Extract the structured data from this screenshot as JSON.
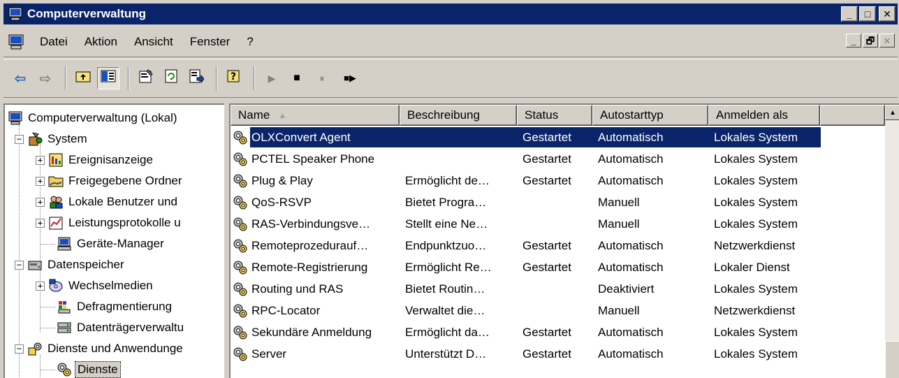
{
  "window": {
    "title": "Computerverwaltung",
    "buttons": {
      "minimize": "_",
      "maximize": "□",
      "close": "✕"
    }
  },
  "menu": {
    "items": [
      "Datei",
      "Aktion",
      "Ansicht",
      "Fenster",
      "?"
    ],
    "child_buttons": {
      "minimize": "_",
      "restore": "🗗",
      "close": "✕"
    }
  },
  "toolbar": {
    "back": "⇦",
    "forward": "⇨",
    "play": "▶",
    "stop": "■",
    "pause": "⏸",
    "restart": "■▶"
  },
  "tree": {
    "root": "Computerverwaltung (Lokal)",
    "items": [
      {
        "label": "System",
        "expander": "−",
        "icon": "tools-icon"
      },
      {
        "label": "Ereignisanzeige",
        "expander": "+",
        "icon": "event-viewer-icon"
      },
      {
        "label": "Freigegebene Ordner",
        "expander": "+",
        "icon": "shared-folder-icon"
      },
      {
        "label": "Lokale Benutzer und",
        "expander": "+",
        "icon": "users-icon"
      },
      {
        "label": "Leistungsprotokolle u",
        "expander": "+",
        "icon": "performance-icon"
      },
      {
        "label": "Geräte-Manager",
        "expander": "",
        "icon": "device-manager-icon"
      },
      {
        "label": "Datenspeicher",
        "expander": "−",
        "icon": "storage-icon"
      },
      {
        "label": "Wechselmedien",
        "expander": "+",
        "icon": "removable-media-icon"
      },
      {
        "label": "Defragmentierung",
        "expander": "",
        "icon": "defrag-icon"
      },
      {
        "label": "Datenträgerverwaltu",
        "expander": "",
        "icon": "disk-management-icon"
      },
      {
        "label": "Dienste und Anwendunge",
        "expander": "−",
        "icon": "services-apps-icon"
      },
      {
        "label": "Dienste",
        "expander": "",
        "icon": "services-icon"
      }
    ]
  },
  "list": {
    "columns": [
      "Name",
      "Beschreibung",
      "Status",
      "Autostarttyp",
      "Anmelden als"
    ],
    "sort_indicator": "▲",
    "rows": [
      {
        "name": "OLXConvert Agent",
        "desc": "",
        "status": "Gestartet",
        "startup": "Automatisch",
        "logon": "Lokales System"
      },
      {
        "name": "PCTEL Speaker Phone",
        "desc": "",
        "status": "Gestartet",
        "startup": "Automatisch",
        "logon": "Lokales System"
      },
      {
        "name": "Plug & Play",
        "desc": "Ermöglicht de…",
        "status": "Gestartet",
        "startup": "Automatisch",
        "logon": "Lokales System"
      },
      {
        "name": "QoS-RSVP",
        "desc": "Bietet Progra…",
        "status": "",
        "startup": "Manuell",
        "logon": "Lokales System"
      },
      {
        "name": "RAS-Verbindungsve…",
        "desc": "Stellt eine Ne…",
        "status": "",
        "startup": "Manuell",
        "logon": "Lokales System"
      },
      {
        "name": "Remoteprozedurauf…",
        "desc": "Endpunktzuo…",
        "status": "Gestartet",
        "startup": "Automatisch",
        "logon": "Netzwerkdienst"
      },
      {
        "name": "Remote-Registrierung",
        "desc": "Ermöglicht Re…",
        "status": "Gestartet",
        "startup": "Automatisch",
        "logon": "Lokaler Dienst"
      },
      {
        "name": "Routing und RAS",
        "desc": "Bietet Routin…",
        "status": "",
        "startup": "Deaktiviert",
        "logon": "Lokales System"
      },
      {
        "name": "RPC-Locator",
        "desc": "Verwaltet die…",
        "status": "",
        "startup": "Manuell",
        "logon": "Netzwerkdienst"
      },
      {
        "name": "Sekundäre Anmeldung",
        "desc": "Ermöglicht da…",
        "status": "Gestartet",
        "startup": "Automatisch",
        "logon": "Lokales System"
      },
      {
        "name": "Server",
        "desc": "Unterstützt D…",
        "status": "Gestartet",
        "startup": "Automatisch",
        "logon": "Lokales System"
      }
    ]
  },
  "colors": {
    "titlebar": "#0a246a",
    "selection": "#0a246a",
    "face": "#d4d0c8"
  }
}
